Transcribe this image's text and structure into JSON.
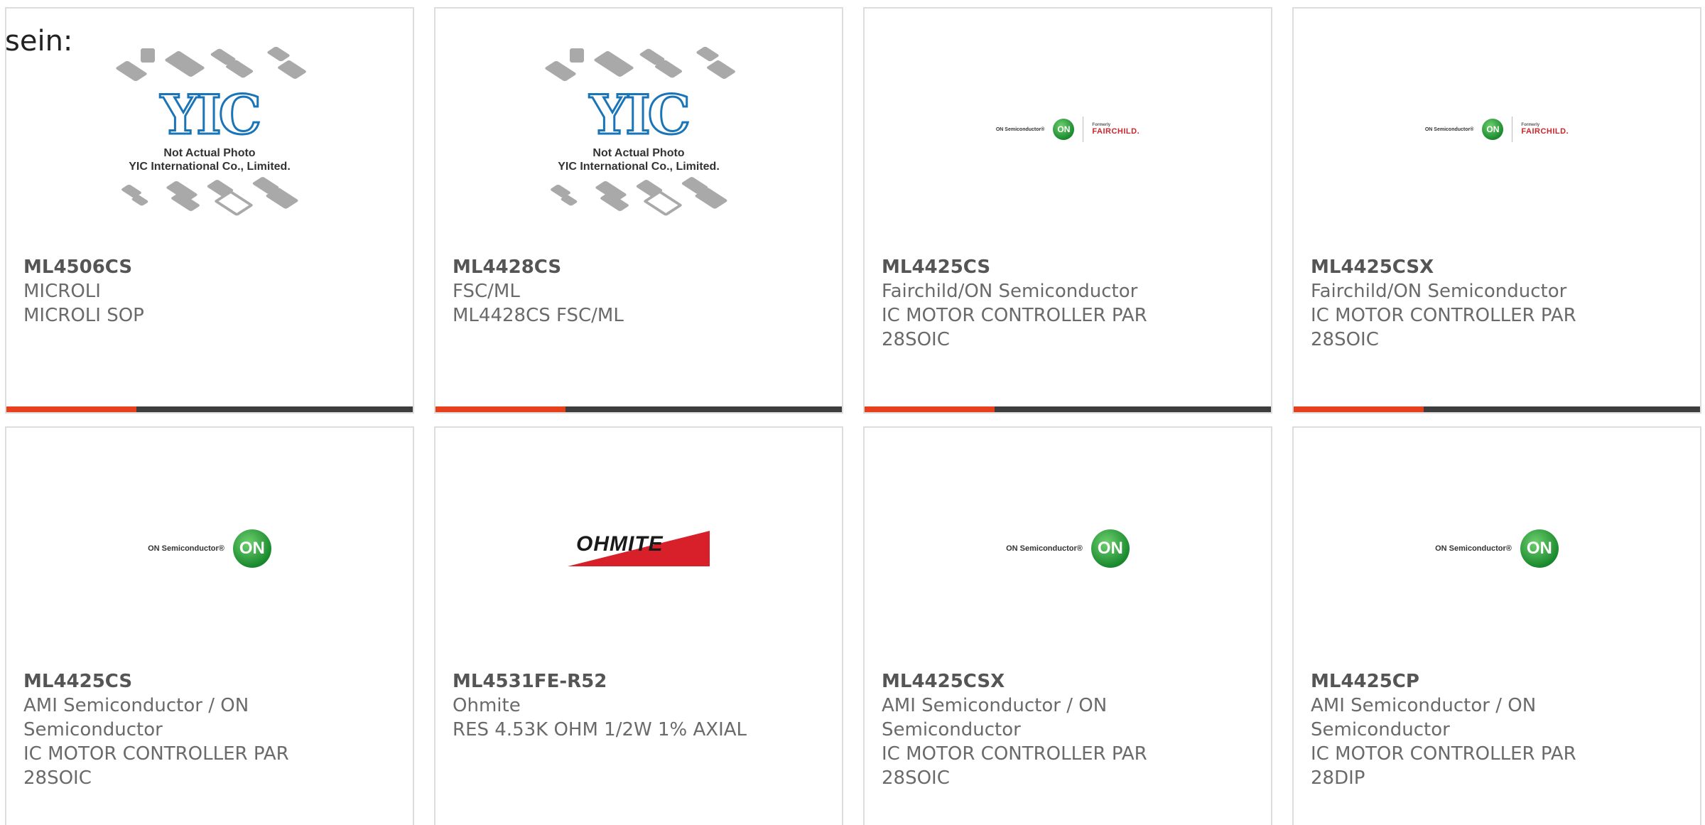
{
  "lead_text": "sein:",
  "placeholder": {
    "logo_text": "YIC",
    "caption_line1": "Not Actual Photo",
    "caption_line2": "YIC International Co., Limited."
  },
  "logos": {
    "on_word": "ON Semiconductor®",
    "on_mark": "ON",
    "fair_formerly": "Formerly",
    "fair_name": "FAIRCHILD.",
    "ohmite_name": "OHMITE"
  },
  "colors": {
    "accent": "#e8401c",
    "bar_dark": "#3d3d3d",
    "on_green": "#1a8a2e",
    "ohmite_red": "#d8202a"
  },
  "products": [
    {
      "part": "ML4506CS",
      "maker": "MICROLI",
      "desc": "MICROLI SOP"
    },
    {
      "part": "ML4428CS",
      "maker": "FSC/ML",
      "desc": "ML4428CS FSC/ML"
    },
    {
      "part": "ML4425CS",
      "maker": "Fairchild/ON Semiconductor",
      "desc": "IC MOTOR CONTROLLER PAR 28SOIC"
    },
    {
      "part": "ML4425CSX",
      "maker": "Fairchild/ON Semiconductor",
      "desc": "IC MOTOR CONTROLLER PAR 28SOIC"
    },
    {
      "part": "ML4425CS",
      "maker": "AMI Semiconductor / ON Semiconductor",
      "desc": "IC MOTOR CONTROLLER PAR 28SOIC"
    },
    {
      "part": "ML4531FE-R52",
      "maker": "Ohmite",
      "desc": "RES 4.53K OHM 1/2W 1% AXIAL"
    },
    {
      "part": "ML4425CSX",
      "maker": "AMI Semiconductor / ON Semiconductor",
      "desc": "IC MOTOR CONTROLLER PAR 28SOIC"
    },
    {
      "part": "ML4425CP",
      "maker": "AMI Semiconductor / ON Semiconductor",
      "desc": "IC MOTOR CONTROLLER PAR 28DIP"
    }
  ]
}
